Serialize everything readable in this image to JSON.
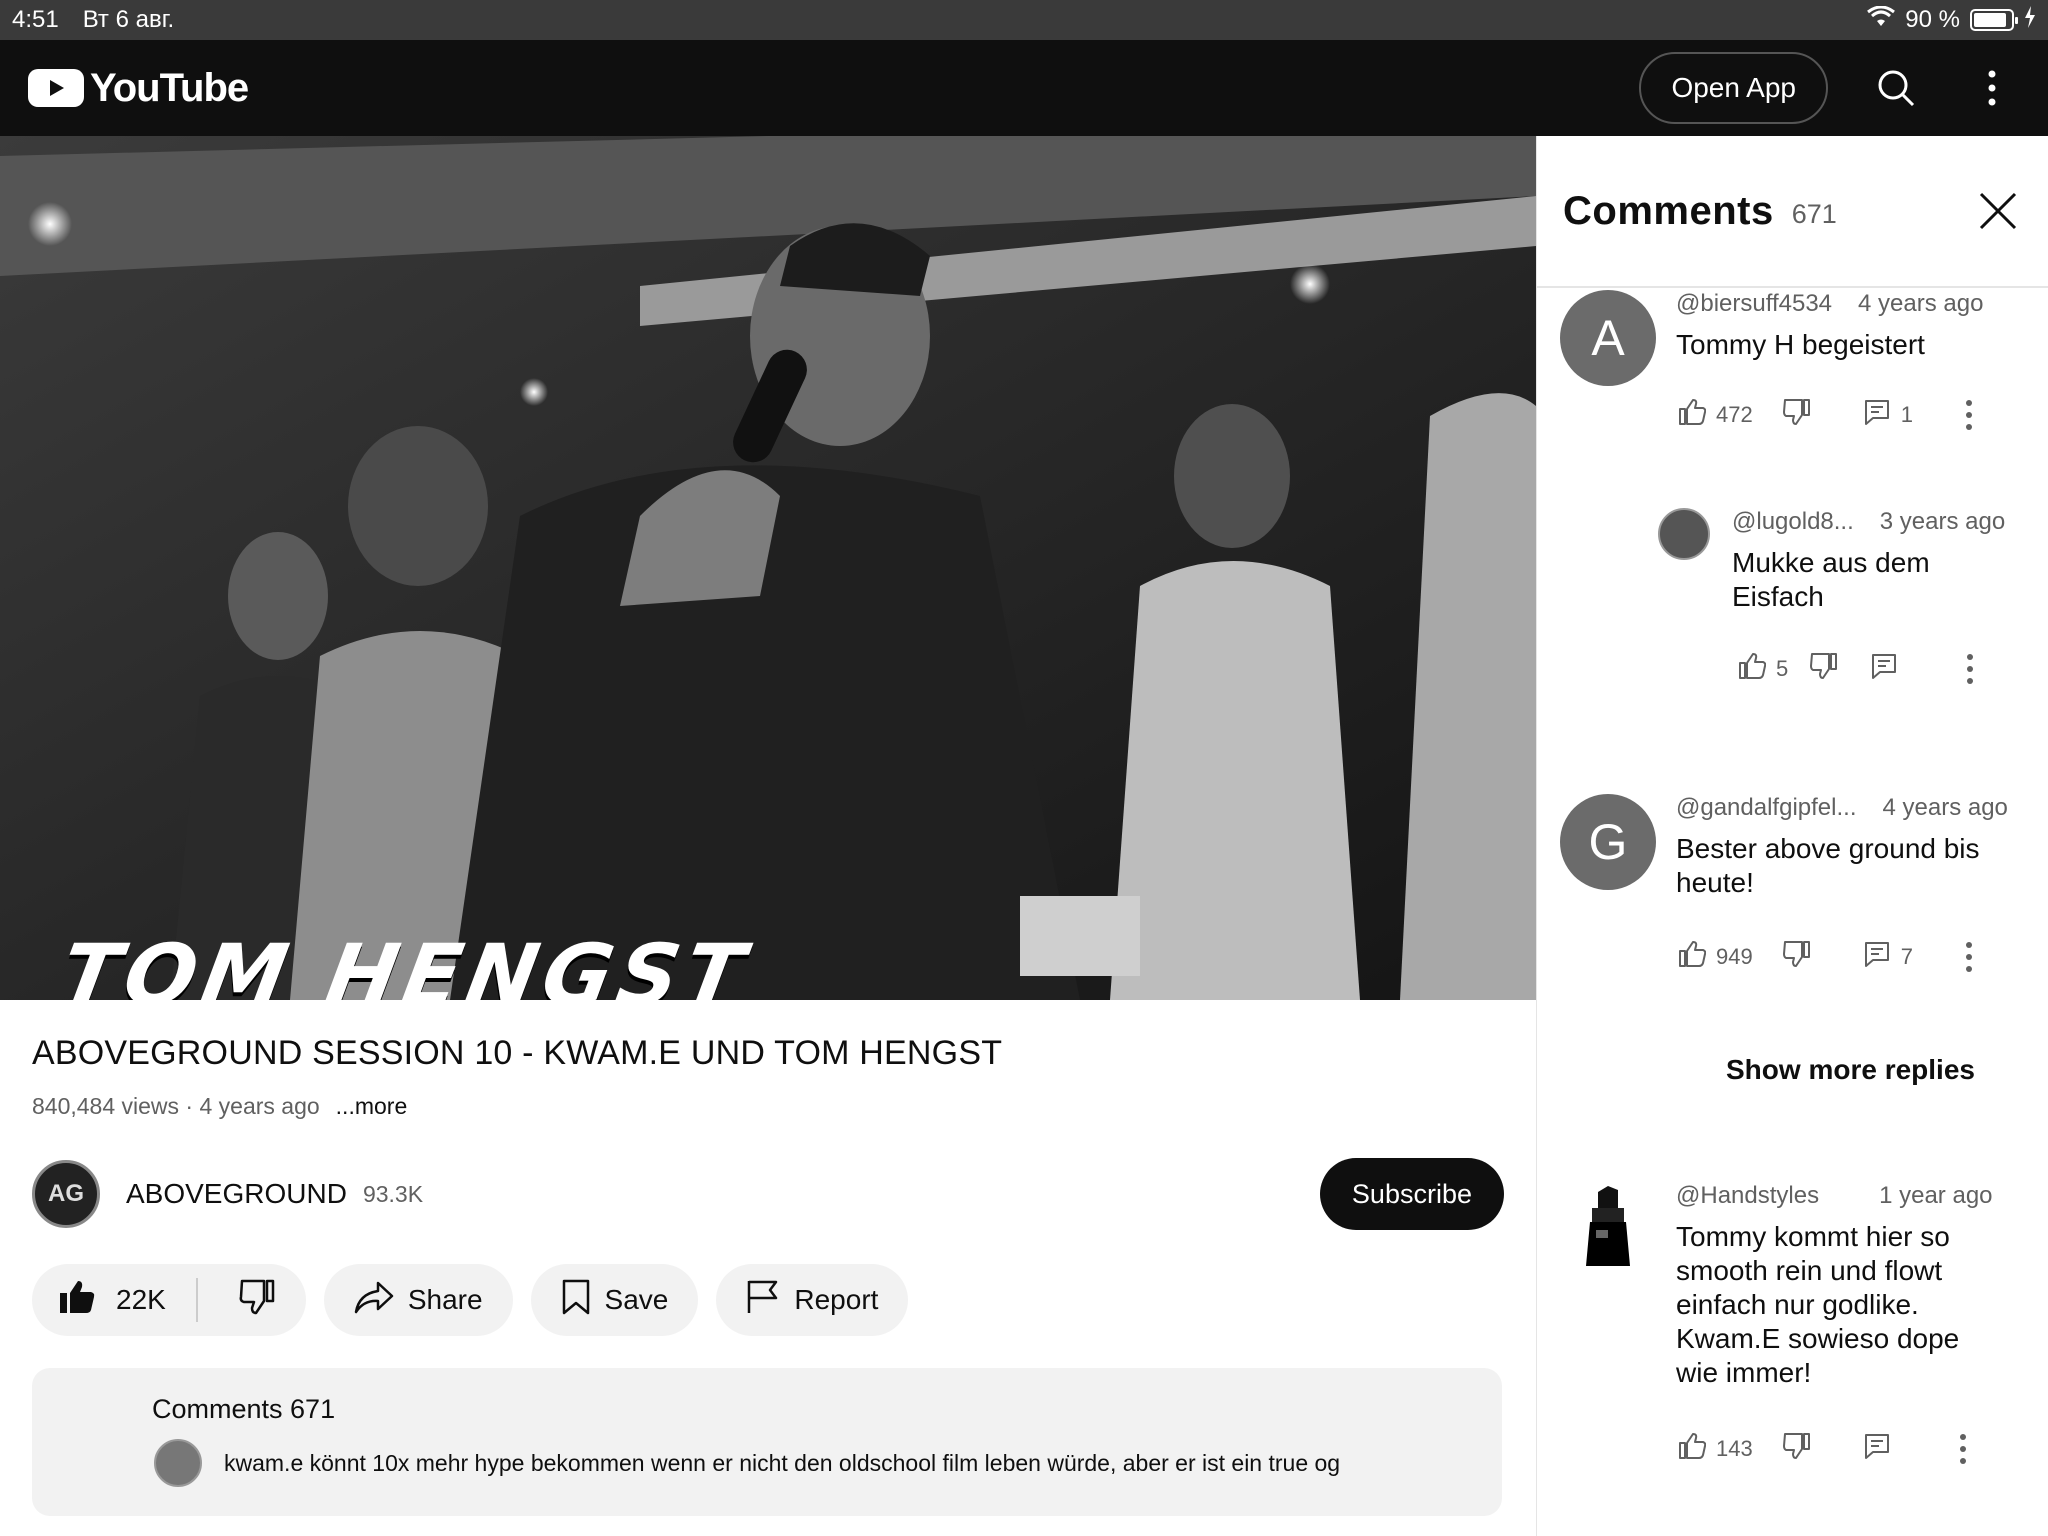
{
  "status_bar": {
    "time": "4:51",
    "date": "Вт 6 авг.",
    "battery": "90 %",
    "battery_level": 0.9
  },
  "header": {
    "brand": "YouTube",
    "open_app": "Open App"
  },
  "video": {
    "overlay_title": "TOM HENGST",
    "title": "ABOVEGROUND SESSION 10 - KWAM.E UND TOM HENGST",
    "views": "840,484 views · 4 years ago",
    "more": "...more"
  },
  "channel": {
    "name": "ABOVEGROUND",
    "subscribers": "93.3K",
    "avatar_initials": "AG",
    "subscribe": "Subscribe"
  },
  "actions": {
    "likes": "22K",
    "share": "Share",
    "save": "Save",
    "report": "Report"
  },
  "comments_preview": {
    "title": "Comments 671",
    "text": "kwam.e könnt 10x mehr hype bekommen wenn er nicht den oldschool film leben würde, aber er ist ein true og"
  },
  "panel": {
    "title": "Comments",
    "count": "671",
    "comments": [
      {
        "avatar": "A",
        "author": "@biersuff4534",
        "time": "4 years ago",
        "text": "Tommy H begeistert",
        "likes": "472",
        "replies": "1"
      },
      {
        "author": "@lugold8...",
        "time": "3 years ago",
        "text": "Mukke aus dem Eisfach",
        "likes": "5"
      },
      {
        "avatar": "G",
        "author": "@gandalfgipfel...",
        "time": "4 years ago",
        "text": "Bester above ground bis heute!",
        "likes": "949",
        "replies": "7"
      },
      {
        "author": "@Handstyles",
        "time": "1 year ago",
        "text": "Tommy kommt hier so smooth rein und flowt einfach nur godlike. Kwam.E sowieso dope wie immer!",
        "likes": "143"
      }
    ],
    "show_more": "Show more replies"
  }
}
